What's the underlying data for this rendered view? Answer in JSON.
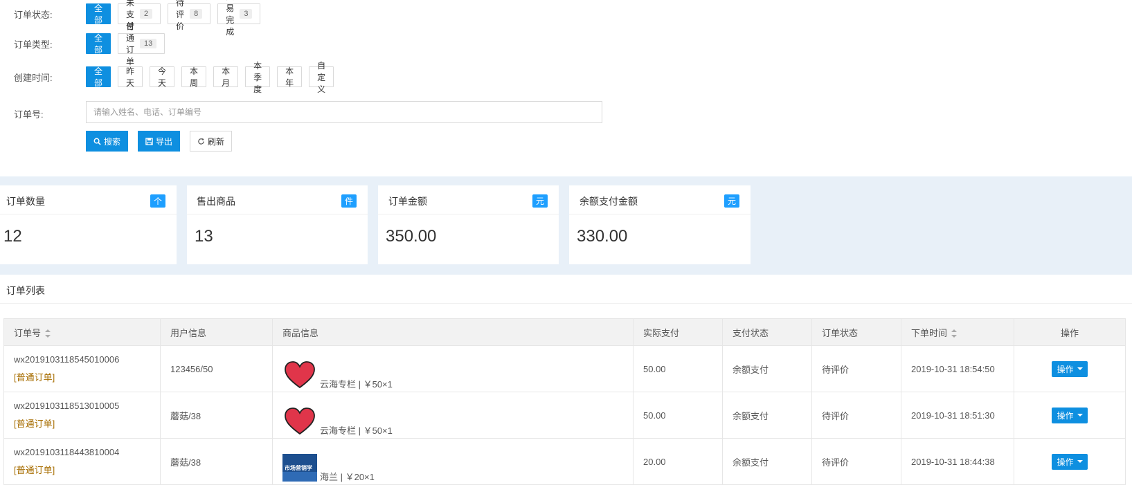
{
  "filters": {
    "status": {
      "label": "订单状态:",
      "options": [
        {
          "label": "全部",
          "count": null,
          "active": true
        },
        {
          "label": "未支付",
          "count": "2",
          "active": false
        },
        {
          "label": "待评价",
          "count": "8",
          "active": false
        },
        {
          "label": "交易完成",
          "count": "3",
          "active": false
        }
      ]
    },
    "type": {
      "label": "订单类型:",
      "options": [
        {
          "label": "全部",
          "count": null,
          "active": true
        },
        {
          "label": "普通订单",
          "count": "13",
          "active": false
        }
      ]
    },
    "time": {
      "label": "创建时间:",
      "options": [
        "全部",
        "昨天",
        "今天",
        "本周",
        "本月",
        "本季度",
        "本年",
        "自定义"
      ]
    },
    "order_no": {
      "label": "订单号:",
      "placeholder": "请输入姓名、电话、订单编号",
      "value": ""
    },
    "actions": {
      "search": "搜索",
      "export": "导出",
      "refresh": "刷新"
    }
  },
  "stats": [
    {
      "title": "订单数量",
      "badge": "个",
      "value": "12"
    },
    {
      "title": "售出商品",
      "badge": "件",
      "value": "13"
    },
    {
      "title": "订单金额",
      "badge": "元",
      "value": "350.00"
    },
    {
      "title": "余额支付金额",
      "badge": "元",
      "value": "330.00"
    }
  ],
  "list": {
    "title": "订单列表",
    "headers": [
      "订单号",
      "用户信息",
      "商品信息",
      "实际支付",
      "支付状态",
      "订单状态",
      "下单时间",
      "操作"
    ],
    "rows": [
      {
        "order_no": "wx2019103118545010006",
        "order_type": "[普通订单]",
        "user": "123456/50",
        "goods_icon": "heart-icon",
        "goods": "云海专栏 | ￥50×1",
        "paid": "50.00",
        "pay_status": "余额支付",
        "order_status": "待评价",
        "time": "2019-10-31 18:54:50",
        "op": "操作"
      },
      {
        "order_no": "wx2019103118513010005",
        "order_type": "[普通订单]",
        "user": "蘑菇/38",
        "goods_icon": "heart-icon",
        "goods": "云海专栏 | ￥50×1",
        "paid": "50.00",
        "pay_status": "余额支付",
        "order_status": "待评价",
        "time": "2019-10-31 18:51:30",
        "op": "操作"
      },
      {
        "order_no": "wx2019103118443810004",
        "order_type": "[普通订单]",
        "user": "蘑菇/38",
        "goods_icon": "book-cover",
        "goods_cover_text": "市场营销学",
        "goods": "海兰 | ￥20×1",
        "paid": "20.00",
        "pay_status": "余额支付",
        "order_status": "待评价",
        "time": "2019-10-31 18:44:38",
        "op": "操作"
      }
    ]
  },
  "colors": {
    "primary": "#0e8fe0",
    "badge": "#1e9fff",
    "stats_bg": "#e8f0f8",
    "order_type": "#a76d00",
    "heart": "#e0354a"
  }
}
